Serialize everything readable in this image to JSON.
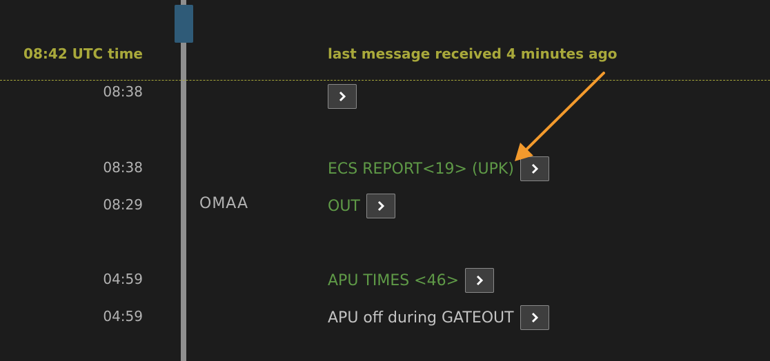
{
  "header": {
    "utc_time": "08:42 UTC time",
    "last_message": "last message received 4 minutes ago"
  },
  "messages": [
    {
      "time": "08:38",
      "station": "",
      "label": ""
    },
    {
      "time": "08:38",
      "station": "",
      "label": "ECS REPORT<19> (UPK)"
    },
    {
      "time": "08:29",
      "station": "OMAA",
      "label": "OUT"
    },
    {
      "time": "04:59",
      "station": "",
      "label": "APU TIMES <46>"
    },
    {
      "time": "04:59",
      "station": "",
      "label": "APU off during GATEOUT"
    }
  ],
  "icons": {
    "expand": "chevron-right-icon",
    "annotation": "orange-arrow-annotation"
  },
  "colors": {
    "accent_olive": "#a9a93b",
    "message_green": "#5f9a47",
    "timeline_handle": "#2f5b78",
    "annotation_orange": "#f39a2d"
  }
}
